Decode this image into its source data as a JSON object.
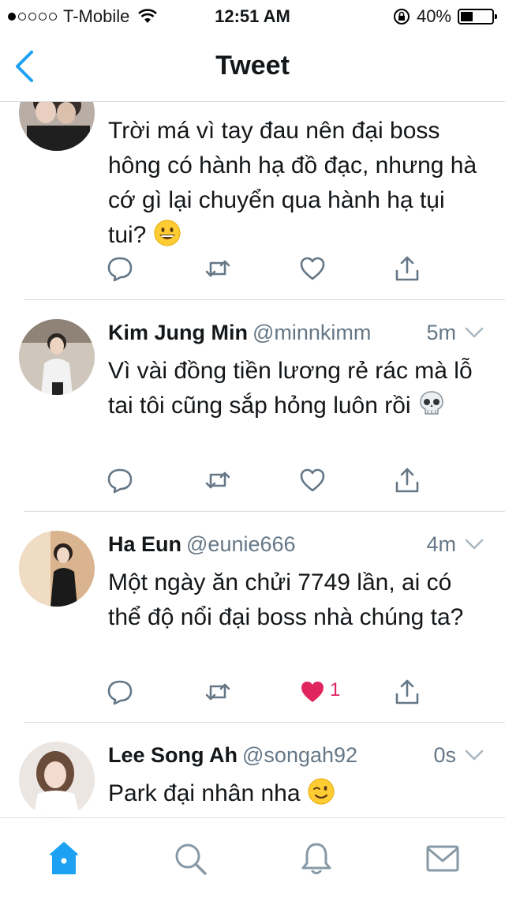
{
  "status_bar": {
    "carrier": "T-Mobile",
    "time": "12:51 AM",
    "battery": "40%",
    "battery_level": 0.4,
    "signal_bars": 1
  },
  "nav": {
    "title": "Tweet"
  },
  "tweets": [
    {
      "text": "Trời má vì tay đau nên đại boss hông có hành hạ đồ đạc, nhưng hà cớ gì lại chuyển qua hành hạ tụi tui?",
      "emoji": "grinning-face"
    },
    {
      "name": "Kim Jung Min",
      "handle": "@minnkimm",
      "time": "5m",
      "text": "Vì vài đồng tiền lương rẻ rác mà lỗ tai tôi cũng sắp hỏng luôn rồi",
      "emoji": "skull"
    },
    {
      "name": "Ha Eun",
      "handle": "@eunie666",
      "time": "4m",
      "text": "Một ngày ăn chửi 7749 lần, ai có thể độ nổi đại boss nhà chúng ta?",
      "like_count": "1",
      "liked": true
    },
    {
      "name": "Lee Song Ah",
      "handle": "@songah92",
      "time": "0s",
      "text": "Park đại nhân nha",
      "emoji": "winking-face"
    }
  ],
  "colors": {
    "accent": "#1da1f2",
    "icon_gray": "#657786",
    "like_red": "#e0245e",
    "separator": "#d8dde1"
  }
}
